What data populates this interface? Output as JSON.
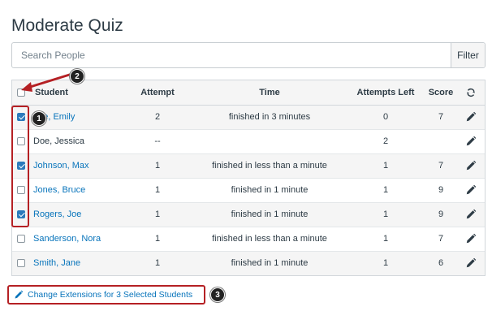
{
  "page": {
    "title": "Moderate Quiz"
  },
  "search": {
    "placeholder": "Search People",
    "filter_label": "Filter"
  },
  "table": {
    "headers": {
      "student": "Student",
      "attempt": "Attempt",
      "time": "Time",
      "attempts_left": "Attempts Left",
      "score": "Score"
    },
    "rows": [
      {
        "student": "Doe, Emily",
        "student_visible": "one, Emily",
        "checked": true,
        "linked": true,
        "attempt": "2",
        "time": "finished in 3 minutes",
        "attempts_left": "0",
        "score": "7"
      },
      {
        "student": "Doe, Jessica",
        "checked": false,
        "linked": false,
        "attempt": "--",
        "time": "",
        "attempts_left": "2",
        "score": ""
      },
      {
        "student": "Johnson, Max",
        "checked": true,
        "linked": true,
        "attempt": "1",
        "time": "finished in less than a minute",
        "attempts_left": "1",
        "score": "7"
      },
      {
        "student": "Jones, Bruce",
        "checked": false,
        "linked": true,
        "attempt": "1",
        "time": "finished in 1 minute",
        "attempts_left": "1",
        "score": "9"
      },
      {
        "student": "Rogers, Joe",
        "checked": true,
        "linked": true,
        "attempt": "1",
        "time": "finished in 1 minute",
        "attempts_left": "1",
        "score": "9"
      },
      {
        "student": "Sanderson, Nora",
        "checked": false,
        "linked": true,
        "attempt": "1",
        "time": "finished in less than a minute",
        "attempts_left": "1",
        "score": "7"
      },
      {
        "student": "Smith, Jane",
        "checked": false,
        "linked": true,
        "attempt": "1",
        "time": "finished in 1 minute",
        "attempts_left": "1",
        "score": "6"
      }
    ]
  },
  "extensions_button": {
    "label": "Change Extensions for 3 Selected Students"
  },
  "callouts": {
    "one": "1",
    "two": "2",
    "three": "3"
  },
  "icons": {
    "refresh": "refresh-icon",
    "edit": "pencil-icon"
  },
  "colors": {
    "link": "#0874bb",
    "highlight": "#b52024",
    "checkbox_checked": "#2b7abc",
    "row_stripe": "#f5f5f5"
  }
}
